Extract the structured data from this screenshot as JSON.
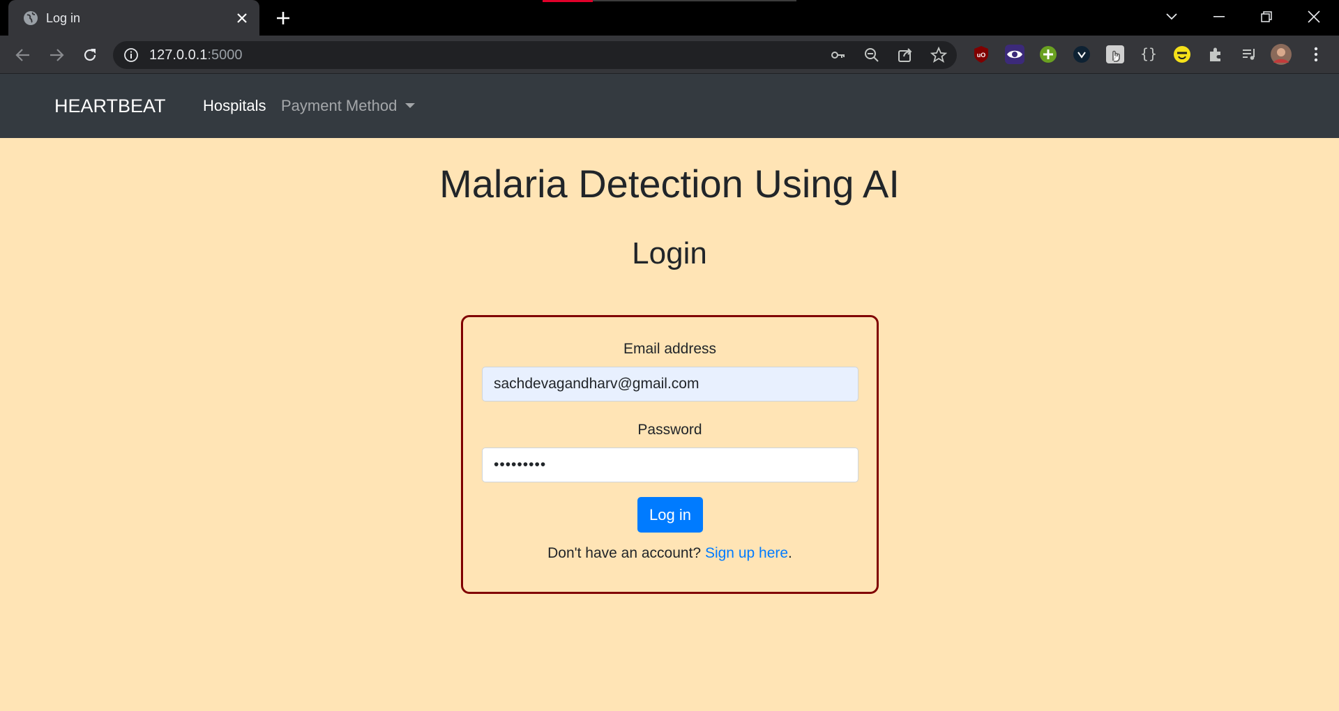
{
  "browser": {
    "tab_title": "Log in",
    "url_host": "127.0.0.1",
    "url_port": ":5000"
  },
  "navbar": {
    "brand": "HEARTBEAT",
    "links": [
      {
        "label": "Hospitals",
        "active": true
      },
      {
        "label": "Payment Method",
        "dropdown": true
      }
    ]
  },
  "main": {
    "title": "Malaria Detection Using AI",
    "subtitle": "Login"
  },
  "form": {
    "email_label": "Email address",
    "email_value": "sachdevagandharv@gmail.com",
    "password_label": "Password",
    "password_masked": "•••••••••",
    "submit_label": "Log in",
    "signup_prompt": "Don't have an account? ",
    "signup_link": "Sign up here",
    "signup_suffix": "."
  },
  "colors": {
    "page_background": "#ffe4b5",
    "navbar": "#343a40",
    "card_border": "#800000",
    "primary_button": "#007bff",
    "link": "#007bff",
    "autofill_background": "#e8f0fe"
  }
}
